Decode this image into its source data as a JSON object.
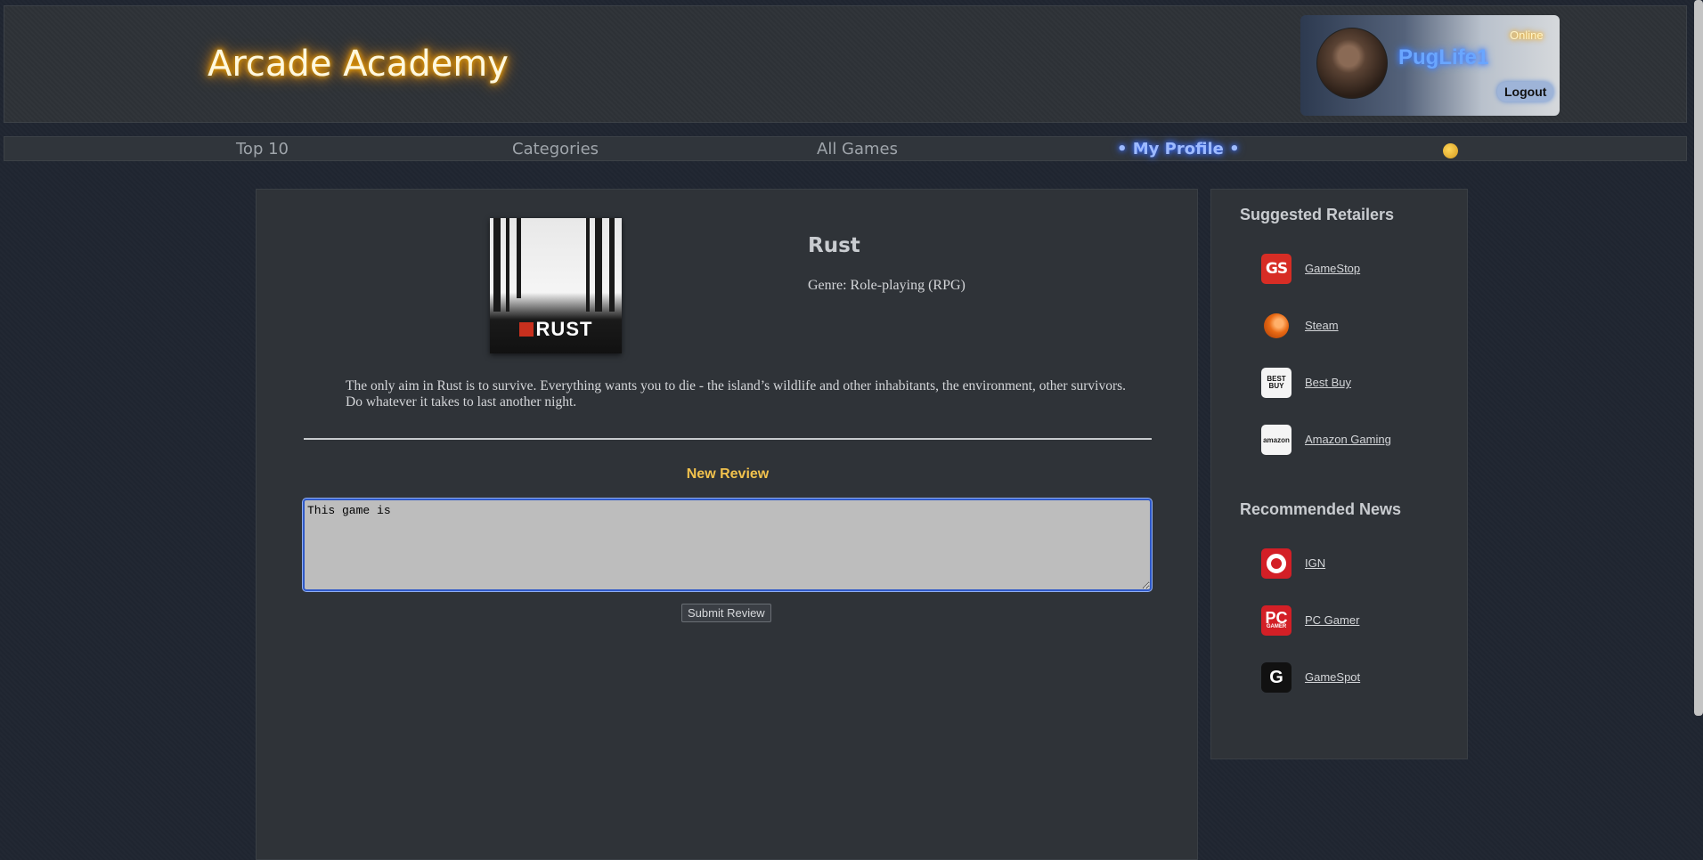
{
  "header": {
    "site_title": "Arcade Academy",
    "profile": {
      "username": "PugLife1",
      "status": "Online",
      "logout_label": "Logout"
    }
  },
  "nav": {
    "items": [
      {
        "label": "Top 10"
      },
      {
        "label": "Categories"
      },
      {
        "label": "All Games"
      },
      {
        "label": "• My Profile •"
      }
    ],
    "active_item": "• My Profile •",
    "theme_icon": "emoji-face-icon"
  },
  "game": {
    "title": "Rust",
    "genre": "Genre: Role-playing (RPG)",
    "cover_logo_text": "RUST",
    "description": "The only aim in Rust is to survive. Everything wants you to die - the island’s wildlife and other inhabitants, the environment, other survivors. Do whatever it takes to last another night."
  },
  "review": {
    "heading": "New Review",
    "input_value": "This game is ",
    "submit_label": "Submit Review"
  },
  "sidebar": {
    "retailers_heading": "Suggested Retailers",
    "retailers": [
      {
        "label": "GameStop",
        "icon": "gamestop-icon",
        "icon_text": "GS"
      },
      {
        "label": "Steam",
        "icon": "steam-icon"
      },
      {
        "label": "Best Buy",
        "icon": "bestbuy-icon",
        "icon_text": "BEST BUY"
      },
      {
        "label": "Amazon Gaming",
        "icon": "amazon-icon",
        "icon_text": "amazon"
      }
    ],
    "news_heading": "Recommended News",
    "news": [
      {
        "label": "IGN",
        "icon": "ign-icon"
      },
      {
        "label": "PC Gamer",
        "icon": "pcgamer-icon",
        "icon_text": "PC",
        "icon_subtext": "GAMER"
      },
      {
        "label": "GameSpot",
        "icon": "gamespot-icon",
        "icon_text": "G"
      }
    ]
  },
  "colors": {
    "background": "#1f2530",
    "panel": "#2f3338",
    "title_glow": "#ffb300",
    "accent_blue": "#6aa6ff",
    "review_heading": "#f2c24d"
  }
}
